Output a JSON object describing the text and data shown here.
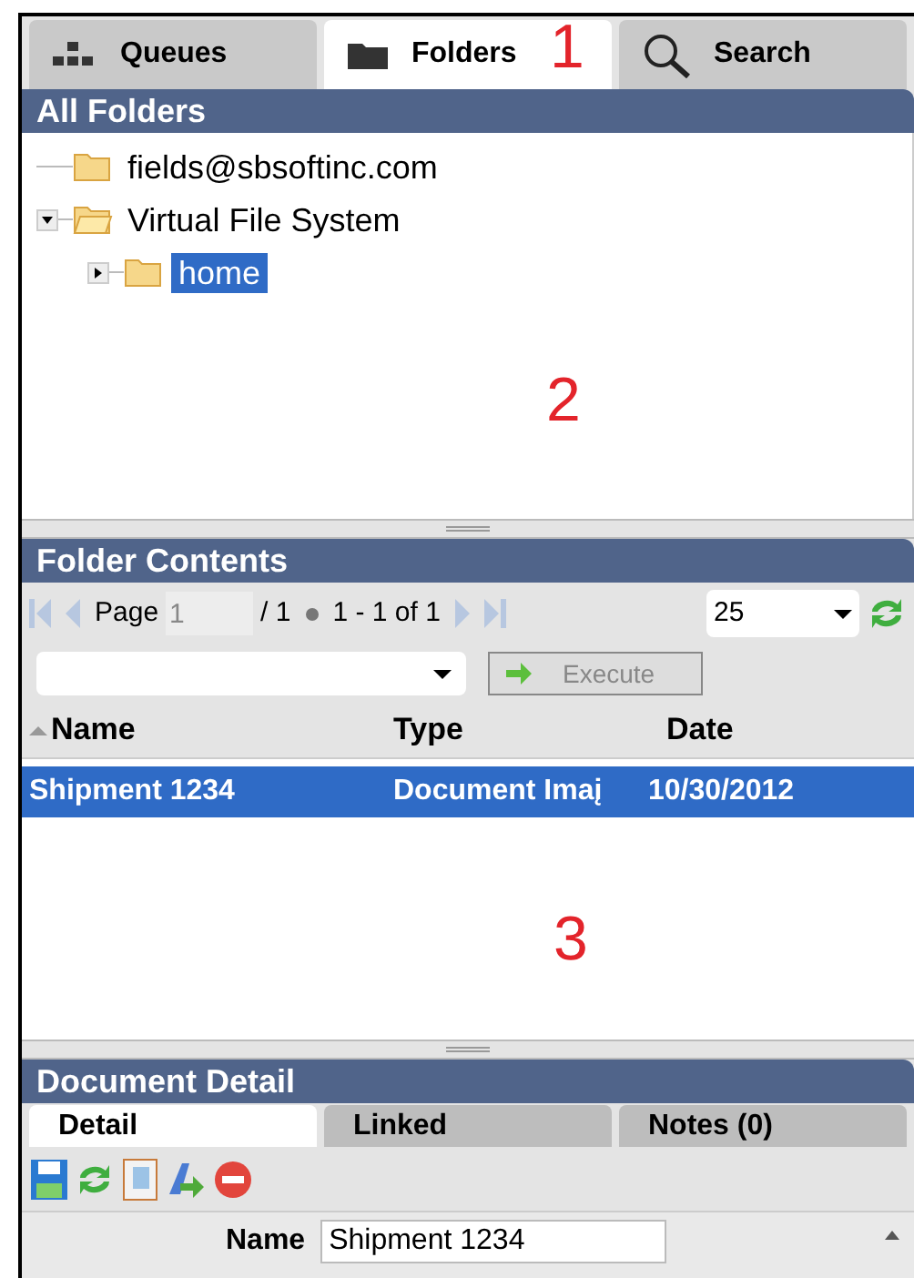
{
  "tabs": [
    {
      "label": "Queues",
      "selected": false
    },
    {
      "label": "Folders",
      "selected": true
    },
    {
      "label": "Search",
      "selected": false
    }
  ],
  "annotations": [
    "1",
    "2",
    "3"
  ],
  "all_folders": {
    "title": "All Folders",
    "tree": [
      {
        "label": "fields@sbsoftinc.com",
        "selected": false
      },
      {
        "label": "Virtual File System",
        "expanded": true,
        "selected": false,
        "children": [
          {
            "label": "home",
            "expanded": false,
            "selected": true
          }
        ]
      }
    ]
  },
  "folder_contents": {
    "title": "Folder Contents",
    "page_label": "Page",
    "page": "1",
    "page_total": "/ 1",
    "range": "1 - 1 of 1",
    "page_size": "25",
    "action_button": "Execute",
    "columns": [
      "Name",
      "Type",
      "Date"
    ],
    "rows": [
      {
        "cells": [
          "Shipment 1234",
          "Document Imaį",
          "10/30/2012"
        ],
        "selected": true
      }
    ]
  },
  "document_detail": {
    "title": "Document Detail",
    "tabs": [
      {
        "label": "Detail",
        "selected": true
      },
      {
        "label": "Linked",
        "selected": false
      },
      {
        "label": "Notes (0)",
        "selected": false
      }
    ],
    "fields": [
      {
        "label": "Name",
        "value": "Shipment 1234"
      }
    ]
  }
}
